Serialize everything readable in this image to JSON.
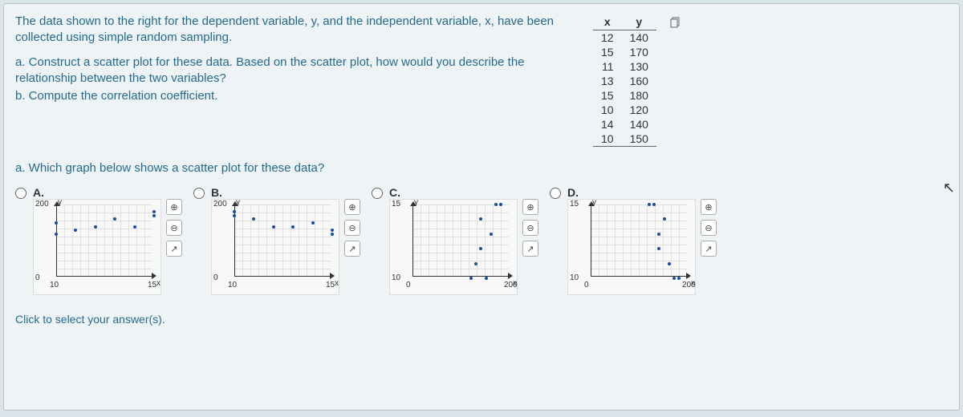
{
  "intro": "The data shown to the right for the dependent variable, y, and the independent variable, x, have been collected using simple random sampling.",
  "parts": {
    "a": "a. Construct a scatter plot for these data. Based on the scatter plot, how would you describe the relationship between the two variables?",
    "b": "b. Compute the correlation coefficient."
  },
  "table": {
    "headers": [
      "x",
      "y"
    ],
    "rows": [
      [
        12,
        140
      ],
      [
        15,
        170
      ],
      [
        11,
        130
      ],
      [
        13,
        160
      ],
      [
        15,
        180
      ],
      [
        10,
        120
      ],
      [
        14,
        140
      ],
      [
        10,
        150
      ]
    ]
  },
  "question_a": "a. Which graph below shows a scatter plot for these data?",
  "options": {
    "A": "A.",
    "B": "B.",
    "C": "C.",
    "D": "D."
  },
  "footer": "Click to select your answer(s).",
  "tool_labels": {
    "zoom_in": "⊕",
    "zoom_out": "⊖",
    "popout": "↗"
  },
  "chart_data": [
    {
      "type": "scatter",
      "option": "A",
      "xlabel": "x",
      "ylabel": "y",
      "xlim": [
        10,
        15
      ],
      "ylim": [
        0,
        200
      ],
      "xticks": [
        10,
        15
      ],
      "yticks": [
        0,
        200
      ],
      "points": [
        {
          "x": 10,
          "y": 120
        },
        {
          "x": 10,
          "y": 150
        },
        {
          "x": 11,
          "y": 130
        },
        {
          "x": 12,
          "y": 140
        },
        {
          "x": 13,
          "y": 160
        },
        {
          "x": 14,
          "y": 140
        },
        {
          "x": 15,
          "y": 170
        },
        {
          "x": 15,
          "y": 180
        }
      ]
    },
    {
      "type": "scatter",
      "option": "B",
      "xlabel": "x",
      "ylabel": "y",
      "xlim": [
        10,
        15
      ],
      "ylim": [
        0,
        200
      ],
      "xticks": [
        10,
        15
      ],
      "yticks": [
        0,
        200
      ],
      "points": [
        {
          "x": 10,
          "y": 170
        },
        {
          "x": 10,
          "y": 180
        },
        {
          "x": 11,
          "y": 160
        },
        {
          "x": 12,
          "y": 140
        },
        {
          "x": 13,
          "y": 140
        },
        {
          "x": 14,
          "y": 150
        },
        {
          "x": 15,
          "y": 120
        },
        {
          "x": 15,
          "y": 130
        }
      ]
    },
    {
      "type": "scatter",
      "option": "C",
      "xlabel": "x",
      "ylabel": "y",
      "xlim": [
        0,
        200
      ],
      "ylim": [
        10,
        15
      ],
      "xticks": [
        0,
        200
      ],
      "yticks": [
        10,
        15
      ],
      "points": [
        {
          "x": 120,
          "y": 10
        },
        {
          "x": 150,
          "y": 10
        },
        {
          "x": 130,
          "y": 11
        },
        {
          "x": 140,
          "y": 12
        },
        {
          "x": 160,
          "y": 13
        },
        {
          "x": 140,
          "y": 14
        },
        {
          "x": 170,
          "y": 15
        },
        {
          "x": 180,
          "y": 15
        }
      ]
    },
    {
      "type": "scatter",
      "option": "D",
      "xlabel": "x",
      "ylabel": "y",
      "xlim": [
        0,
        200
      ],
      "ylim": [
        10,
        15
      ],
      "xticks": [
        0,
        200
      ],
      "yticks": [
        10,
        15
      ],
      "points": [
        {
          "x": 170,
          "y": 10
        },
        {
          "x": 180,
          "y": 10
        },
        {
          "x": 160,
          "y": 11
        },
        {
          "x": 140,
          "y": 12
        },
        {
          "x": 140,
          "y": 13
        },
        {
          "x": 150,
          "y": 14
        },
        {
          "x": 120,
          "y": 15
        },
        {
          "x": 130,
          "y": 15
        }
      ]
    }
  ]
}
